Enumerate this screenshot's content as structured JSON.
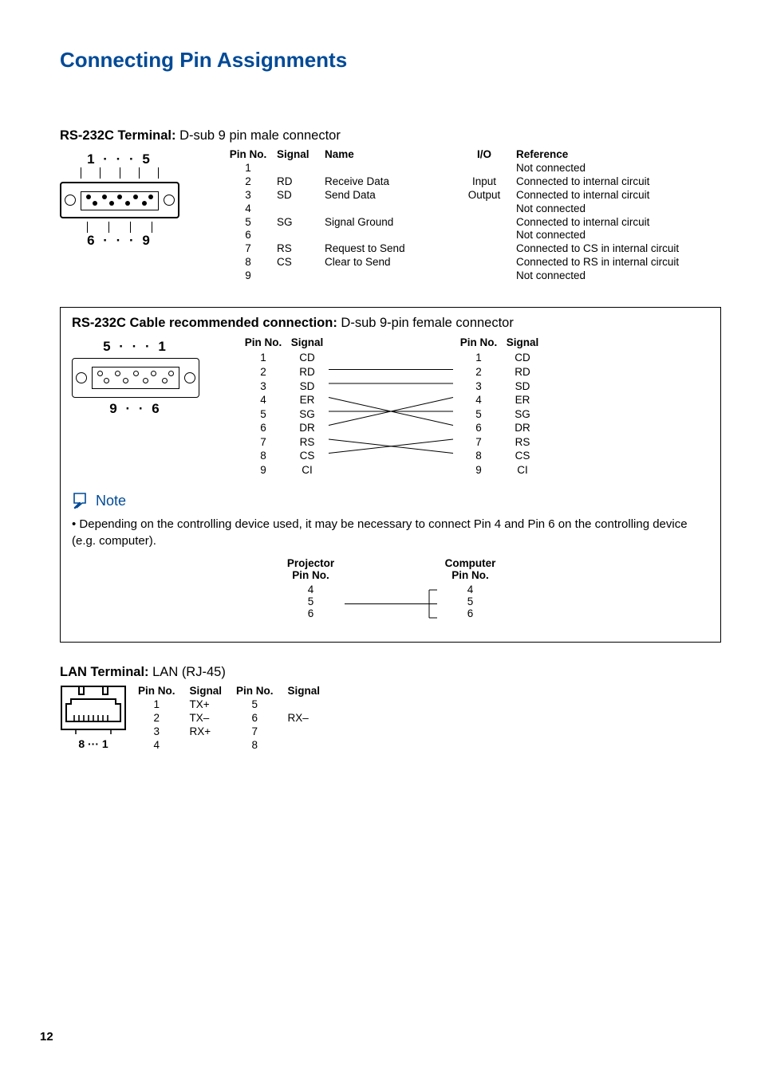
{
  "title": "Connecting Pin Assignments",
  "rs232c_terminal": {
    "heading_bold": "RS-232C Terminal:",
    "heading_rest": " D-sub 9 pin male connector",
    "diagram_labels": {
      "top": "1 · · · 5",
      "bottom": "6 · · · 9"
    },
    "columns": {
      "pin": "Pin No.",
      "signal": "Signal",
      "name": "Name",
      "io": "I/O",
      "reference": "Reference"
    },
    "rows": [
      {
        "pin": "1",
        "signal": "",
        "name": "",
        "io": "",
        "reference": "Not connected"
      },
      {
        "pin": "2",
        "signal": "RD",
        "name": "Receive Data",
        "io": "Input",
        "reference": "Connected to internal circuit"
      },
      {
        "pin": "3",
        "signal": "SD",
        "name": "Send Data",
        "io": "Output",
        "reference": "Connected to internal circuit"
      },
      {
        "pin": "4",
        "signal": "",
        "name": "",
        "io": "",
        "reference": "Not connected"
      },
      {
        "pin": "5",
        "signal": "SG",
        "name": "Signal Ground",
        "io": "",
        "reference": "Connected to internal circuit"
      },
      {
        "pin": "6",
        "signal": "",
        "name": "",
        "io": "",
        "reference": "Not connected"
      },
      {
        "pin": "7",
        "signal": "RS",
        "name": "Request to Send",
        "io": "",
        "reference": "Connected to CS in internal circuit"
      },
      {
        "pin": "8",
        "signal": "CS",
        "name": "Clear to Send",
        "io": "",
        "reference": "Connected to RS in internal circuit"
      },
      {
        "pin": "9",
        "signal": "",
        "name": "",
        "io": "",
        "reference": "Not connected"
      }
    ]
  },
  "cable": {
    "heading_bold": "RS-232C Cable recommended connection:",
    "heading_rest": " D-sub 9-pin female connector",
    "diagram_labels": {
      "top": "5  · · ·  1",
      "bottom": "9  · ·  6"
    },
    "columns": {
      "pin": "Pin No.",
      "signal": "Signal"
    },
    "left_rows": [
      {
        "pin": "1",
        "signal": "CD"
      },
      {
        "pin": "2",
        "signal": "RD"
      },
      {
        "pin": "3",
        "signal": "SD"
      },
      {
        "pin": "4",
        "signal": "ER"
      },
      {
        "pin": "5",
        "signal": "SG"
      },
      {
        "pin": "6",
        "signal": "DR"
      },
      {
        "pin": "7",
        "signal": "RS"
      },
      {
        "pin": "8",
        "signal": "CS"
      },
      {
        "pin": "9",
        "signal": "CI"
      }
    ],
    "right_rows": [
      {
        "pin": "1",
        "signal": "CD"
      },
      {
        "pin": "2",
        "signal": "RD"
      },
      {
        "pin": "3",
        "signal": "SD"
      },
      {
        "pin": "4",
        "signal": "ER"
      },
      {
        "pin": "5",
        "signal": "SG"
      },
      {
        "pin": "6",
        "signal": "DR"
      },
      {
        "pin": "7",
        "signal": "RS"
      },
      {
        "pin": "8",
        "signal": "CS"
      },
      {
        "pin": "9",
        "signal": "CI"
      }
    ],
    "connections": [
      [
        2,
        2
      ],
      [
        3,
        3
      ],
      [
        4,
        6
      ],
      [
        5,
        5
      ],
      [
        6,
        4
      ],
      [
        7,
        8
      ],
      [
        8,
        7
      ]
    ]
  },
  "note": {
    "label": "Note",
    "text": "Depending on the controlling device used, it may be necessary to connect Pin 4 and Pin 6 on the controlling device (e.g. computer).",
    "proj_header": "Projector",
    "proj_sub": "Pin No.",
    "comp_header": "Computer",
    "comp_sub": "Pin No.",
    "proj_pins": [
      "4",
      "5",
      "6"
    ],
    "comp_pins": [
      "4",
      "5",
      "6"
    ]
  },
  "lan": {
    "heading_bold": "LAN Terminal:",
    "heading_rest": " LAN (RJ-45)",
    "diagram_label": "8 ··· 1",
    "columns": {
      "pin": "Pin No.",
      "signal": "Signal"
    },
    "left_rows": [
      {
        "pin": "1",
        "signal": "TX+"
      },
      {
        "pin": "2",
        "signal": "TX–"
      },
      {
        "pin": "3",
        "signal": "RX+"
      },
      {
        "pin": "4",
        "signal": ""
      }
    ],
    "right_rows": [
      {
        "pin": "5",
        "signal": ""
      },
      {
        "pin": "6",
        "signal": "RX–"
      },
      {
        "pin": "7",
        "signal": ""
      },
      {
        "pin": "8",
        "signal": ""
      }
    ]
  },
  "page_number": "12"
}
